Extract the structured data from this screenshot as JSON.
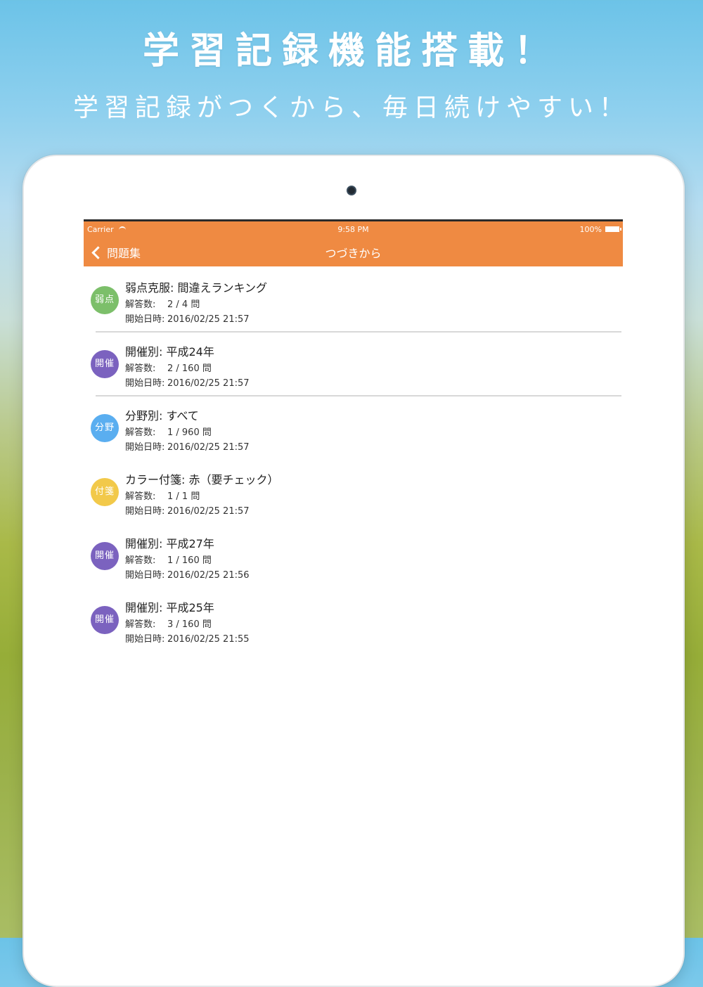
{
  "banner": {
    "headline": "学習記録機能搭載！",
    "subline": "学習記録がつくから、毎日続けやすい！"
  },
  "status_bar": {
    "carrier": "Carrier",
    "time": "9:58 PM",
    "battery": "100%"
  },
  "navbar": {
    "back_label": "問題集",
    "title": "つづきから",
    "color": "#ef8a42"
  },
  "labels": {
    "answered": "解答数:",
    "started": "開始日時:"
  },
  "items": [
    {
      "badge": "弱点",
      "badge_color": "#7cbf6a",
      "title": "弱点克服: 間違えランキング",
      "answered": "2 / 4 問",
      "started": "2016/02/25 21:57",
      "separator": true
    },
    {
      "badge": "開催",
      "badge_color": "#7b62bf",
      "title": "開催別: 平成24年",
      "answered": "2 / 160 問",
      "started": "2016/02/25 21:57",
      "separator": true
    },
    {
      "badge": "分野",
      "badge_color": "#5aaef0",
      "title": "分野別: すべて",
      "answered": "1 / 960 問",
      "started": "2016/02/25 21:57",
      "separator": false
    },
    {
      "badge": "付箋",
      "badge_color": "#f2c94a",
      "title": "カラー付箋: 赤（要チェック）",
      "answered": "1 / 1 問",
      "started": "2016/02/25 21:57",
      "separator": false
    },
    {
      "badge": "開催",
      "badge_color": "#7b62bf",
      "title": "開催別: 平成27年",
      "answered": "1 / 160 問",
      "started": "2016/02/25 21:56",
      "separator": false
    },
    {
      "badge": "開催",
      "badge_color": "#7b62bf",
      "title": "開催別: 平成25年",
      "answered": "3 / 160 問",
      "started": "2016/02/25 21:55",
      "separator": false
    }
  ]
}
